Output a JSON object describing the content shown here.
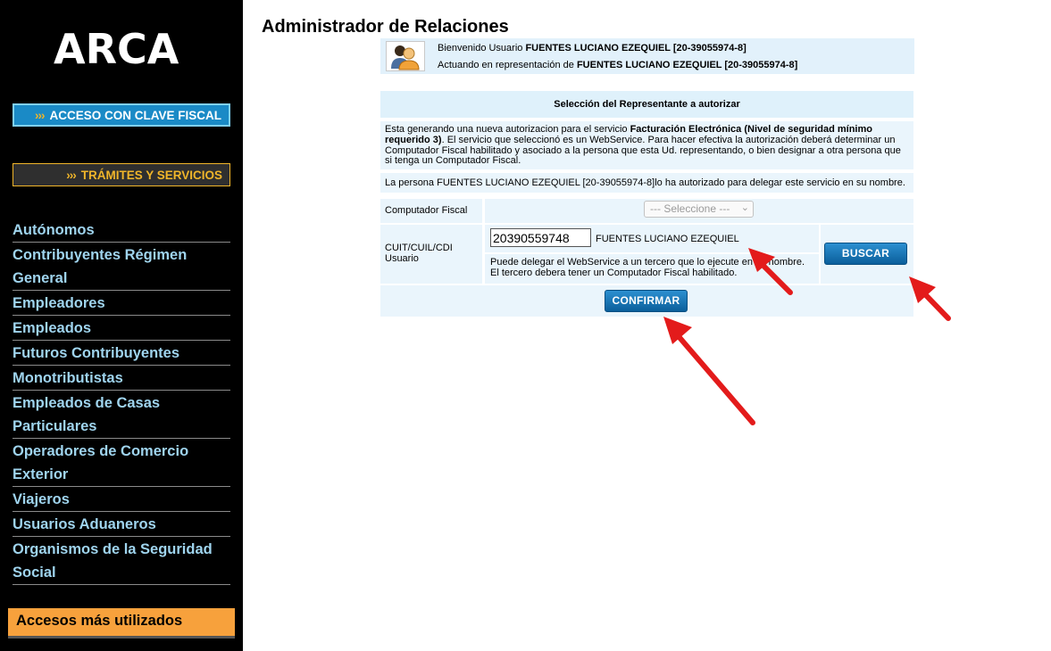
{
  "sidebar": {
    "logo": "ARCA",
    "btn_clave": {
      "chevrons": "›››",
      "label": "ACCESO CON CLAVE FISCAL"
    },
    "btn_tramites": {
      "chevrons": "›››",
      "label": "TRÁMITES Y SERVICIOS"
    },
    "menu": [
      "Autónomos",
      "Contribuyentes Régimen General",
      "Empleadores",
      "Empleados",
      "Futuros Contribuyentes",
      "Monotributistas",
      "Empleados de Casas Particulares",
      "Operadores de Comercio Exterior",
      "Viajeros",
      "Usuarios Aduaneros",
      "Organismos de la Seguridad Social"
    ],
    "accesos": "Accesos más utilizados"
  },
  "main": {
    "title": "Administrador de Relaciones",
    "welcome": {
      "line1_prefix": "Bienvenido Usuario ",
      "line1_name": "FUENTES LUCIANO EZEQUIEL [20-39055974-8]",
      "line2_prefix": "Actuando en representación de ",
      "line2_name": "FUENTES LUCIANO EZEQUIEL [20-39055974-8]"
    },
    "panel": {
      "header": "Selección del Representante a autorizar",
      "desc_1": "Esta generando una nueva autorizacion para el servicio ",
      "desc_service": "Facturación Electrónica (Nivel de seguridad mínimo requerido 3)",
      "desc_2": ". El servicio que seleccionó es un WebService. Para hacer efectiva la autorización deberá determinar un Computador Fiscal habilitado y asociado a la persona que esta Ud. representando, o bien designar a otra persona que si tenga un Computador Fiscal.",
      "delegation": "La persona FUENTES LUCIANO EZEQUIEL [20-39055974-8]lo ha autorizado para delegar este servicio en su nombre.",
      "comp_label": "Computador Fiscal",
      "comp_select": "--- Seleccione ---",
      "cuit_label": "CUIT/CUIL/CDI Usuario",
      "cuit_value": "20390559748",
      "cuit_name": "FUENTES LUCIANO EZEQUIEL",
      "note_1": "Puede delegar el WebService a un tercero que lo ejecute en su nombre.",
      "note_2": "El tercero debera tener un Computador Fiscal habilitado.",
      "buscar": "BUSCAR",
      "confirmar": "CONFIRMAR"
    }
  },
  "colors": {
    "sidebar_bg": "#000000",
    "menu_text": "#9fd4ee",
    "accent_orange": "#f7a13c",
    "accent_yellow": "#f0b52a",
    "button_blue": "#1a7fc0",
    "panel_bg": "#eaf5fc",
    "arrow_red": "#e31b1b"
  },
  "icons": {
    "avatar": "users-icon",
    "arrows": "red-arrow-icon"
  }
}
